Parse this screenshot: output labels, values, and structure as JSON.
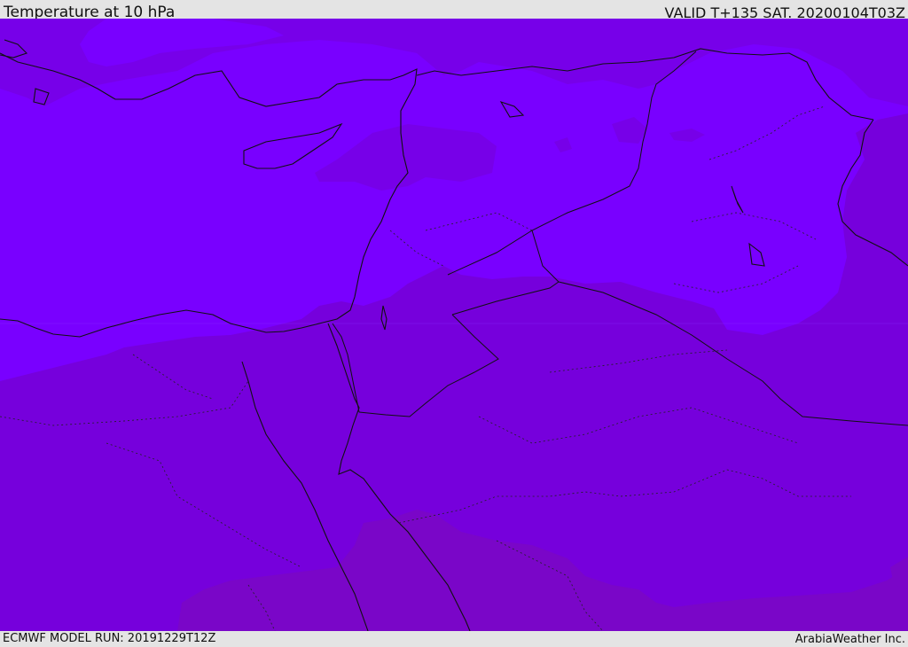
{
  "header": {
    "title": "Temperature at 10 hPa",
    "valid": "VALID T+135 SAT. 20200104T03Z"
  },
  "footer": {
    "model_run": "ECMWF MODEL RUN: 20191229T12Z",
    "credit": "ArabiaWeather Inc."
  },
  "map": {
    "fill_colors": {
      "warmest": "#7a04c4",
      "warm": "#7600dc",
      "cool": "#7a00ff",
      "cold_patch": "#7f00ff"
    },
    "line_color": "#111111"
  }
}
